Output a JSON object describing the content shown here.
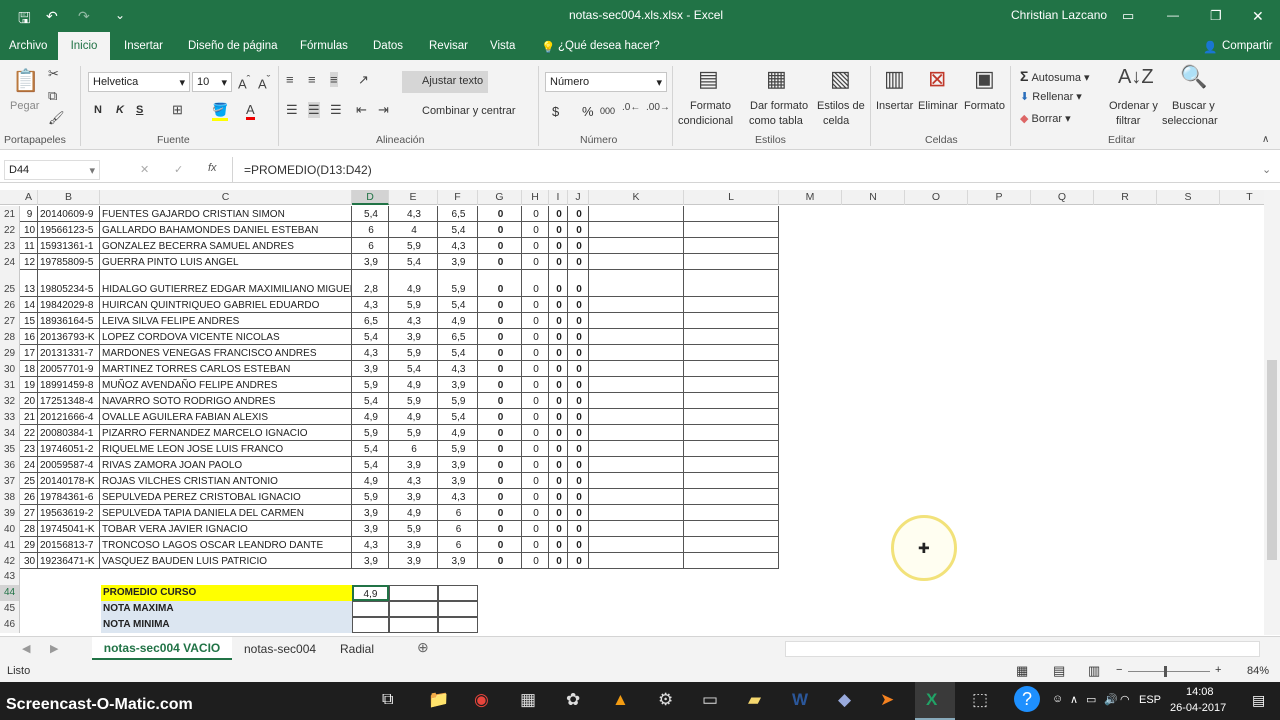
{
  "title": {
    "doc": "notas-sec004.xls.xlsx  -  Excel",
    "user": "Christian Lazcano"
  },
  "icons": {
    "save": "save-icon",
    "undo": "undo-icon",
    "redo": "redo-icon",
    "customize": "customize-icon",
    "ribbon_display": "ribbon-display-icon",
    "minimize": "minimize-icon",
    "maximize": "maximize-icon",
    "close": "close-icon",
    "lightbulb": "lightbulb-icon",
    "share": "share-icon"
  },
  "menu": [
    "Archivo",
    "Inicio",
    "Insertar",
    "Diseño de página",
    "Fórmulas",
    "Datos",
    "Revisar",
    "Vista"
  ],
  "tell_me": "¿Qué desea hacer?",
  "share": "Compartir",
  "ribbon": {
    "paste": "Pegar",
    "clipboard": "Portapapeles",
    "font_name": "Helvetica",
    "font_size": "10",
    "font_group": "Fuente",
    "bold": "N",
    "italic": "K",
    "underline": "S",
    "wrap": "Ajustar texto",
    "merge": "Combinar y centrar",
    "align_group": "Alineación",
    "num_format": "Número",
    "num_group": "Número",
    "currency": "$",
    "percent": "%",
    "thousands": "000",
    "cond_format": "Formato",
    "cond_format2": "condicional",
    "table_format": "Dar formato",
    "table_format2": "como tabla",
    "cell_styles": "Estilos de",
    "cell_styles2": "celda",
    "styles_group": "Estilos",
    "insert": "Insertar",
    "delete": "Eliminar",
    "format": "Formato",
    "cells_group": "Celdas",
    "autosum": "Autosuma",
    "fill": "Rellenar",
    "clear": "Borrar",
    "sort": "Ordenar y",
    "sort2": "filtrar",
    "find": "Buscar y",
    "find2": "seleccionar",
    "edit_group": "Editar"
  },
  "formula_bar": {
    "name_box": "D44",
    "fx": "fx",
    "formula": "=PROMEDIO(D13:D42)",
    "cancel": "✕",
    "enter": "✓"
  },
  "columns": [
    "A",
    "B",
    "C",
    "D",
    "E",
    "F",
    "G",
    "H",
    "I",
    "J",
    "K",
    "L",
    "M",
    "N",
    "O",
    "P",
    "Q",
    "R",
    "S",
    "T"
  ],
  "rows": [
    {
      "n": "21",
      "a": "9",
      "b": "20140609-9",
      "c": "FUENTES GAJARDO CRISTIAN SIMON",
      "d": "5,4",
      "e": "4,3",
      "f": "6,5",
      "g": "0",
      "h": "0",
      "i": "0",
      "j": "0"
    },
    {
      "n": "22",
      "a": "10",
      "b": "19566123-5",
      "c": "GALLARDO BAHAMONDES DANIEL ESTEBAN",
      "d": "6",
      "e": "4",
      "f": "5,4",
      "g": "0",
      "h": "0",
      "i": "0",
      "j": "0"
    },
    {
      "n": "23",
      "a": "11",
      "b": "15931361-1",
      "c": "GONZALEZ BECERRA SAMUEL ANDRES",
      "d": "6",
      "e": "5,9",
      "f": "4,3",
      "g": "0",
      "h": "0",
      "i": "0",
      "j": "0"
    },
    {
      "n": "24",
      "a": "12",
      "b": "19785809-5",
      "c": "GUERRA PINTO LUIS ANGEL",
      "d": "3,9",
      "e": "5,4",
      "f": "3,9",
      "g": "0",
      "h": "0",
      "i": "0",
      "j": "0"
    },
    {
      "n": "25",
      "a": "13",
      "b": "19805234-5",
      "c": "HIDALGO GUTIERREZ EDGAR MAXIMILIANO MIGUEL",
      "d": "2,8",
      "e": "4,9",
      "f": "5,9",
      "g": "0",
      "h": "0",
      "i": "0",
      "j": "0"
    },
    {
      "n": "26",
      "a": "14",
      "b": "19842029-8",
      "c": "HUIRCAN QUINTRIQUEO GABRIEL EDUARDO",
      "d": "4,3",
      "e": "5,9",
      "f": "5,4",
      "g": "0",
      "h": "0",
      "i": "0",
      "j": "0"
    },
    {
      "n": "27",
      "a": "15",
      "b": "18936164-5",
      "c": "LEIVA SILVA FELIPE ANDRES",
      "d": "6,5",
      "e": "4,3",
      "f": "4,9",
      "g": "0",
      "h": "0",
      "i": "0",
      "j": "0"
    },
    {
      "n": "28",
      "a": "16",
      "b": "20136793-K",
      "c": "LOPEZ CORDOVA VICENTE NICOLAS",
      "d": "5,4",
      "e": "3,9",
      "f": "6,5",
      "g": "0",
      "h": "0",
      "i": "0",
      "j": "0"
    },
    {
      "n": "29",
      "a": "17",
      "b": "20131331-7",
      "c": "MARDONES VENEGAS FRANCISCO ANDRES",
      "d": "4,3",
      "e": "5,9",
      "f": "5,4",
      "g": "0",
      "h": "0",
      "i": "0",
      "j": "0"
    },
    {
      "n": "30",
      "a": "18",
      "b": "20057701-9",
      "c": "MARTINEZ TORRES CARLOS ESTEBAN",
      "d": "3,9",
      "e": "5,4",
      "f": "4,3",
      "g": "0",
      "h": "0",
      "i": "0",
      "j": "0"
    },
    {
      "n": "31",
      "a": "19",
      "b": "18991459-8",
      "c": "MUÑOZ AVENDAÑO FELIPE ANDRES",
      "d": "5,9",
      "e": "4,9",
      "f": "3,9",
      "g": "0",
      "h": "0",
      "i": "0",
      "j": "0"
    },
    {
      "n": "32",
      "a": "20",
      "b": "17251348-4",
      "c": "NAVARRO SOTO RODRIGO ANDRES",
      "d": "5,4",
      "e": "5,9",
      "f": "5,9",
      "g": "0",
      "h": "0",
      "i": "0",
      "j": "0"
    },
    {
      "n": "33",
      "a": "21",
      "b": "20121666-4",
      "c": "OVALLE AGUILERA FABIAN ALEXIS",
      "d": "4,9",
      "e": "4,9",
      "f": "5,4",
      "g": "0",
      "h": "0",
      "i": "0",
      "j": "0"
    },
    {
      "n": "34",
      "a": "22",
      "b": "20080384-1",
      "c": "PIZARRO FERNANDEZ MARCELO IGNACIO",
      "d": "5,9",
      "e": "5,9",
      "f": "4,9",
      "g": "0",
      "h": "0",
      "i": "0",
      "j": "0"
    },
    {
      "n": "35",
      "a": "23",
      "b": "19746051-2",
      "c": "RIQUELME LEON JOSE LUIS FRANCO",
      "d": "5,4",
      "e": "6",
      "f": "5,9",
      "g": "0",
      "h": "0",
      "i": "0",
      "j": "0"
    },
    {
      "n": "36",
      "a": "24",
      "b": "20059587-4",
      "c": "RIVAS ZAMORA JOAN PAOLO",
      "d": "5,4",
      "e": "3,9",
      "f": "3,9",
      "g": "0",
      "h": "0",
      "i": "0",
      "j": "0"
    },
    {
      "n": "37",
      "a": "25",
      "b": "20140178-K",
      "c": "ROJAS VILCHES CRISTIAN ANTONIO",
      "d": "4,9",
      "e": "4,3",
      "f": "3,9",
      "g": "0",
      "h": "0",
      "i": "0",
      "j": "0"
    },
    {
      "n": "38",
      "a": "26",
      "b": "19784361-6",
      "c": "SEPULVEDA PEREZ CRISTOBAL IGNACIO",
      "d": "5,9",
      "e": "3,9",
      "f": "4,3",
      "g": "0",
      "h": "0",
      "i": "0",
      "j": "0"
    },
    {
      "n": "39",
      "a": "27",
      "b": "19563619-2",
      "c": "SEPULVEDA TAPIA DANIELA DEL CARMEN",
      "d": "3,9",
      "e": "4,9",
      "f": "6",
      "g": "0",
      "h": "0",
      "i": "0",
      "j": "0"
    },
    {
      "n": "40",
      "a": "28",
      "b": "19745041-K",
      "c": "TOBAR VERA JAVIER IGNACIO",
      "d": "3,9",
      "e": "5,9",
      "f": "6",
      "g": "0",
      "h": "0",
      "i": "0",
      "j": "0"
    },
    {
      "n": "41",
      "a": "29",
      "b": "20156813-7",
      "c": "TRONCOSO LAGOS OSCAR LEANDRO DANTE",
      "d": "4,3",
      "e": "3,9",
      "f": "6",
      "g": "0",
      "h": "0",
      "i": "0",
      "j": "0"
    },
    {
      "n": "42",
      "a": "30",
      "b": "19236471-K",
      "c": "VASQUEZ BAUDEN LUIS PATRICIO",
      "d": "3,9",
      "e": "3,9",
      "f": "3,9",
      "g": "0",
      "h": "0",
      "i": "0",
      "j": "0"
    }
  ],
  "summary": [
    {
      "n": "43",
      "label": "",
      "value": ""
    },
    {
      "n": "44",
      "label": "PROMEDIO CURSO",
      "value": "4,9"
    },
    {
      "n": "45",
      "label": "NOTA MAXIMA",
      "value": ""
    },
    {
      "n": "46",
      "label": "NOTA MINIMA",
      "value": ""
    }
  ],
  "sheets": [
    "notas-sec004 VACIO",
    "notas-sec004",
    "Radial"
  ],
  "status": {
    "left": "Listo",
    "zoom": "84%"
  },
  "taskbar": {
    "brand": "Screencast-O-Matic.com",
    "lang": "ESP",
    "time": "14:08",
    "date": "26-04-2017"
  },
  "colors": {
    "excel_green": "#217346",
    "highlight_yellow": "#ffff00",
    "highlight_blue": "#dce6f1"
  }
}
